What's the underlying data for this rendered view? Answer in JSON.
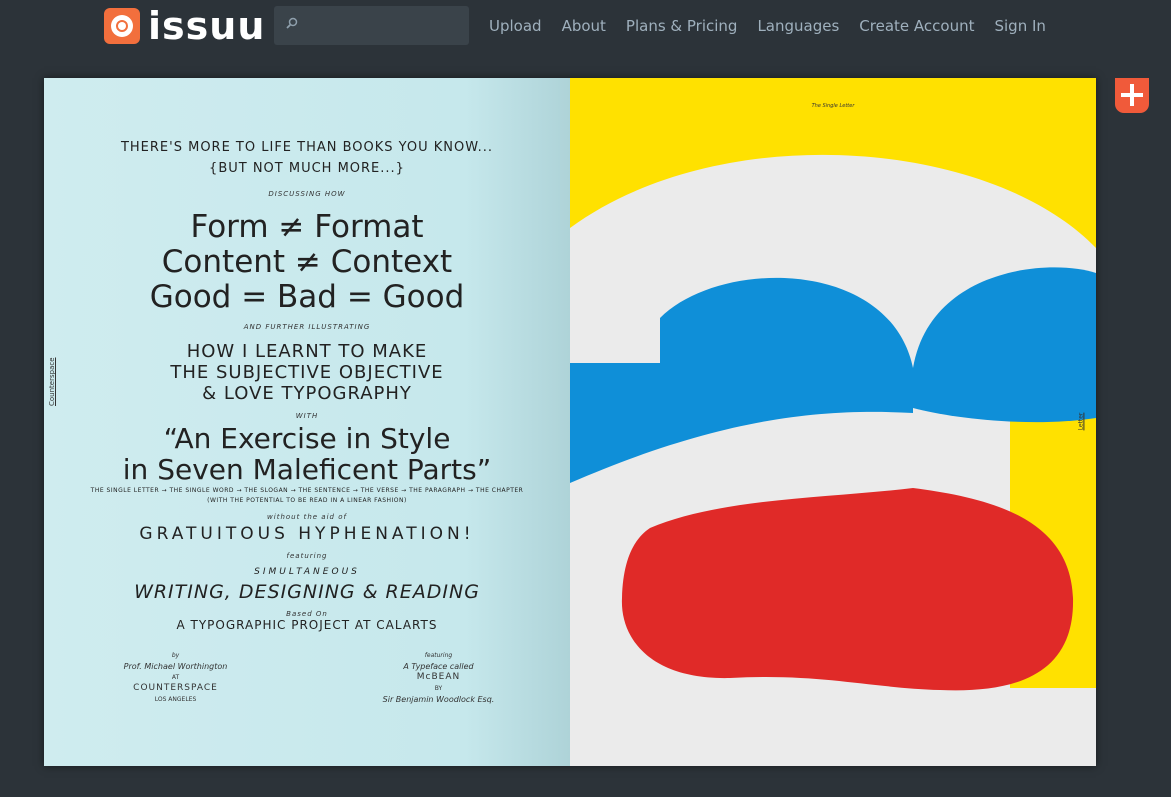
{
  "brand": {
    "logo_text": "issuu",
    "accent": "#f26f3d"
  },
  "search": {
    "placeholder": "",
    "icon": "search-icon"
  },
  "nav": {
    "items": [
      {
        "label": "Upload"
      },
      {
        "label": "About"
      },
      {
        "label": "Plans & Pricing"
      },
      {
        "label": "Languages"
      },
      {
        "label": "Create Account"
      },
      {
        "label": "Sign In"
      }
    ]
  },
  "action": {
    "icon": "plus-icon",
    "color": "#f05a3a"
  },
  "left_page": {
    "side_label": "Counterspace",
    "line1": "THERE'S MORE TO LIFE THAN BOOKS YOU KNOW...",
    "line2": "{BUT NOT MUCH MORE...}",
    "discussing": "DISCUSSING HOW",
    "big1": "Form ≠ Format",
    "big2": "Content ≠ Context",
    "big3": "Good = Bad = Good",
    "further": "AND FURTHER ILLUSTRATING",
    "mid1": "HOW I LEARNT TO MAKE",
    "mid2": "THE SUBJECTIVE OBJECTIVE",
    "mid3": "& LOVE TYPOGRAPHY",
    "with": "WITH",
    "quote1": "“An Exercise in Style",
    "quote2": "in Seven Maleficent Parts”",
    "parts": "THE SINGLE LETTER → THE SINGLE WORD → THE SLOGAN → THE SENTENCE → THE VERSE → THE PARAGRAPH → THE CHAPTER",
    "potential": "(WITH THE POTENTIAL TO BE READ IN A LINEAR FASHION)",
    "without": "without the aid of",
    "gratuitous": "GRATUITOUS HYPHENATION!",
    "featuring": "featuring",
    "simultaneous": "SIMULTANEOUS",
    "wdr": "WRITING, DESIGNING & READING",
    "based_on": "Based On",
    "project": "A TYPOGRAPHIC PROJECT AT CALARTS",
    "credit_left": {
      "by": "by",
      "name": "Prof. Michael Worthington",
      "at": "AT",
      "org": "COUNTERSPACE",
      "city": "LOS ANGELES"
    },
    "credit_right": {
      "featuring": "featuring",
      "typeface": "A Typeface called",
      "font": "McBEAN",
      "by": "BY",
      "author": "Sir Benjamin Woodlock Esq."
    }
  },
  "right_page": {
    "running_head": "The Single Letter",
    "side_label": "Letter",
    "colors": {
      "background": "#ffe100",
      "light": "#ebebeb",
      "blue": "#0f8fd8",
      "red": "#e02a28"
    }
  }
}
